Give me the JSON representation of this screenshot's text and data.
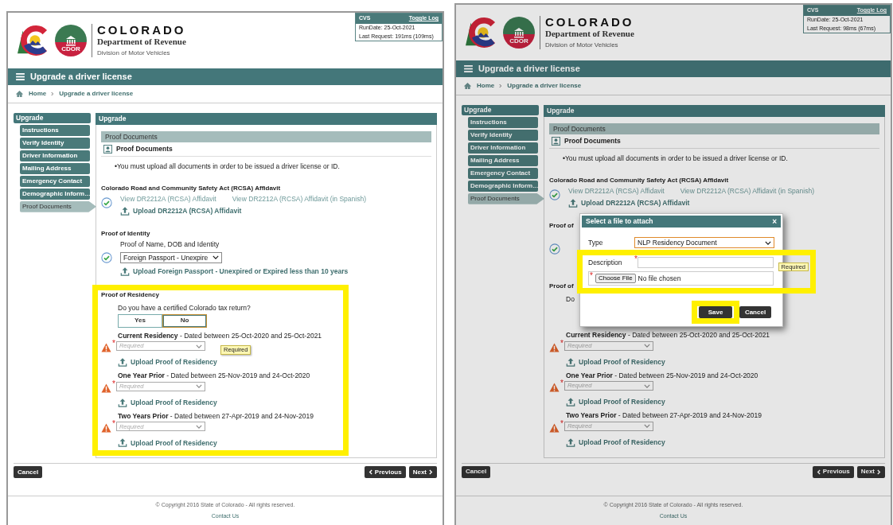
{
  "screens": [
    {
      "backdrop": false,
      "header": {
        "brand": "COLORADO",
        "department": "Department of Revenue",
        "division": "Division of Motor Vehicles",
        "seal": "CDOR"
      },
      "log": {
        "title": "CVS",
        "toggle": "Toggle Log",
        "lines": [
          "RunDate: 25-Oct-2021",
          "Last Request: 191ms (109ms)"
        ]
      },
      "page_title": "Upgrade a driver license",
      "breadcrumb": [
        "Home",
        "Upgrade a driver license"
      ],
      "sidebar": {
        "title": "Upgrade",
        "items": [
          {
            "label": "Instructions",
            "selected": false
          },
          {
            "label": "Verify Identity",
            "selected": false
          },
          {
            "label": "Driver Information",
            "selected": false
          },
          {
            "label": "Mailing Address",
            "selected": false
          },
          {
            "label": "Emergency Contact",
            "selected": false
          },
          {
            "label": "Demographic Inform…",
            "selected": false
          },
          {
            "label": "Proof Documents",
            "selected": true
          }
        ]
      },
      "panel_title": "Upgrade",
      "section_bar": "Proof Documents",
      "section_heading": "Proof Documents",
      "note": "•You must upload all documents in order to be issued a driver license or ID.",
      "blocks": [
        {
          "kind": "affidavit",
          "title": "Colorado Road and Community Safety Act (RCSA) Affidavit",
          "complete": true,
          "links": [
            "View DR2212A (RCSA) Affidavit",
            "View DR2212A (RCSA) Affidavit (in Spanish)"
          ],
          "upload": "Upload DR2212A (RCSA) Affidavit"
        },
        {
          "kind": "identity",
          "title": "Proof of Identity",
          "complete": true,
          "label": "Proof of Name, DOB and Identity",
          "value": "Foreign Passport - Unexpire",
          "upload": "Upload Foreign Passport - Unexpired or Expired less than 10 years"
        },
        {
          "kind": "residency",
          "title": "Proof of Residency",
          "highlighted": true,
          "question": "Do you have a certified Colorado tax return?",
          "options": [
            {
              "label": "Yes",
              "selected": false
            },
            {
              "label": "No",
              "selected": true
            }
          ],
          "periods": [
            {
              "title": "**Current Residency** - Dated between 25-Oct-2020 and 25-Oct-2021",
              "warning": true,
              "marker": "*",
              "placeholder": "Required",
              "tooltip": "Required",
              "upload": "Upload Proof of Residency"
            },
            {
              "title": "**One Year Prior** - Dated between 25-Nov-2019 and 24-Oct-2020",
              "warning": true,
              "marker": "*",
              "placeholder": "Required",
              "upload": "Upload Proof of Residency"
            },
            {
              "title": "**Two Years Prior** - Dated between 27-Apr-2019 and 24-Nov-2019",
              "warning": true,
              "marker": "*",
              "placeholder": "Required",
              "upload": "Upload Proof of Residency"
            }
          ]
        }
      ],
      "actions": {
        "cancel": "Cancel",
        "previous": "Previous",
        "next": "Next"
      },
      "footer": {
        "copyright": "© Copyright 2016 State of Colorado - All rights reserved.",
        "contact": "Contact Us"
      }
    },
    {
      "backdrop": true,
      "header": {
        "brand": "COLORADO",
        "department": "Department of Revenue",
        "division": "Division of Motor Vehicles",
        "seal": "CDOR"
      },
      "log": {
        "title": "CVS",
        "toggle": "Toggle Log",
        "lines": [
          "RunDate: 25-Oct-2021",
          "Last Request: 98ms (67ms)"
        ]
      },
      "page_title": "Upgrade a driver license",
      "breadcrumb": [
        "Home",
        "Upgrade a driver license"
      ],
      "sidebar": {
        "title": "Upgrade",
        "items": [
          {
            "label": "Instructions",
            "selected": false
          },
          {
            "label": "Verify Identity",
            "selected": false
          },
          {
            "label": "Driver Information",
            "selected": false
          },
          {
            "label": "Mailing Address",
            "selected": false
          },
          {
            "label": "Emergency Contact",
            "selected": false
          },
          {
            "label": "Demographic Inform…",
            "selected": false
          },
          {
            "label": "Proof Documents",
            "selected": true
          }
        ]
      },
      "panel_title": "Upgrade",
      "section_bar": "Proof Documents",
      "section_heading": "Proof Documents",
      "note": "•You must upload all documents in order to be issued a driver license or ID.",
      "blocks": [
        {
          "kind": "affidavit",
          "title": "Colorado Road and Community Safety Act (RCSA) Affidavit",
          "complete": true,
          "links": [
            "View DR2212A (RCSA) Affidavit",
            "View DR2212A (RCSA) Affidavit (in Spanish)"
          ],
          "upload": "Upload DR2212A (RCSA) Affidavit"
        },
        {
          "kind": "identity",
          "title": "Proof of",
          "complete": true
        },
        {
          "kind": "residency",
          "title": "Proof of",
          "highlighted": false,
          "question": "Do",
          "periods": [
            {
              "title": "**Current Residency** - Dated between 25-Oct-2020 and 25-Oct-2021",
              "warning": true,
              "marker": "*",
              "placeholder": "Required",
              "upload": "Upload Proof of Residency"
            },
            {
              "title": "**One Year Prior** - Dated between 25-Nov-2019 and 24-Oct-2020",
              "warning": true,
              "marker": "*",
              "placeholder": "Required",
              "upload": "Upload Proof of Residency"
            },
            {
              "title": "**Two Years Prior** - Dated between 27-Apr-2019 and 24-Nov-2019",
              "warning": true,
              "marker": "*",
              "placeholder": "Required",
              "upload": "Upload Proof of Residency"
            }
          ]
        }
      ],
      "actions": {
        "cancel": "Cancel",
        "previous": "Previous",
        "next": "Next"
      },
      "footer": {
        "copyright": "© Copyright 2016 State of Colorado - All rights reserved.",
        "contact": "Contact Us"
      },
      "dialog": {
        "title": "Select a file to attach",
        "close": "×",
        "fields": [
          {
            "kind": "select",
            "label": "Type",
            "value": "NLP Residency Document",
            "highlighted": false
          },
          {
            "kind": "text",
            "label": "Description",
            "marker": "*",
            "tooltip": "Required",
            "highlighted": true
          },
          {
            "kind": "file",
            "marker": "*",
            "button": "Choose File",
            "status": "No file chosen",
            "highlighted": true
          }
        ],
        "buttons": [
          {
            "label": "Save",
            "highlighted": true
          },
          {
            "label": "Cancel",
            "highlighted": false
          }
        ]
      }
    }
  ]
}
